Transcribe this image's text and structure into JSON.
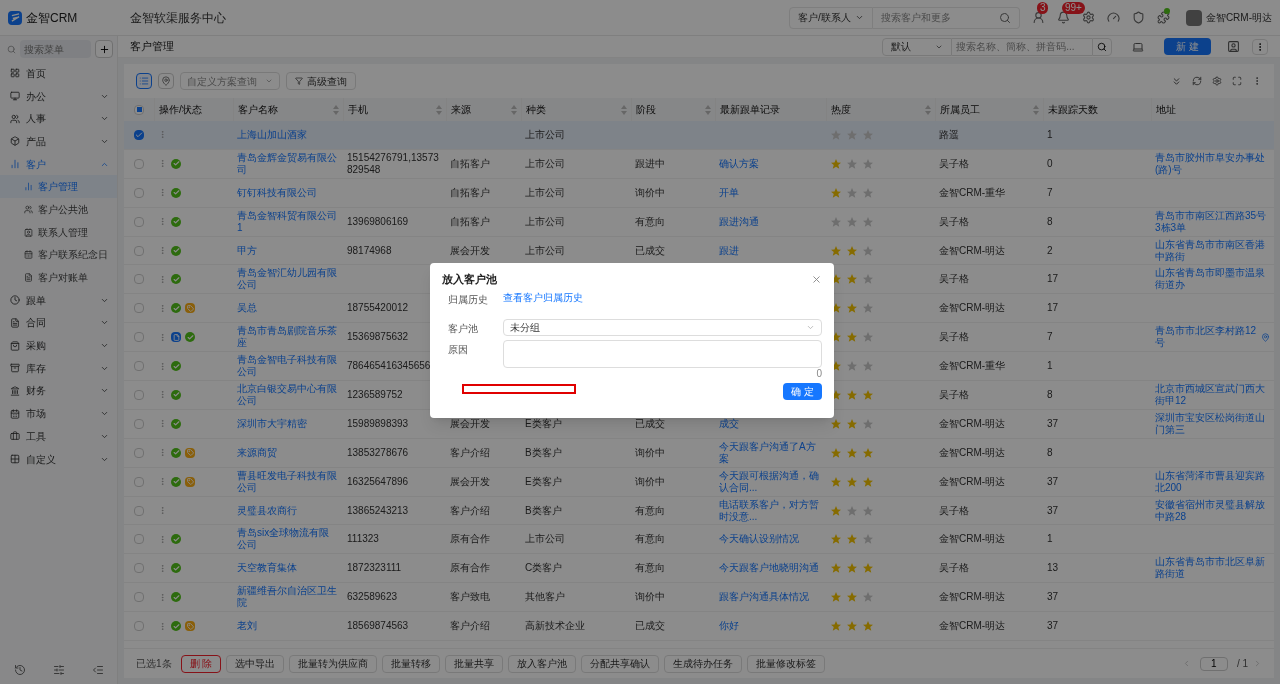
{
  "app": {
    "brand": "金智CRM",
    "title": "金智软渠服务中心",
    "search_scope": "客户/联系人",
    "search_placeholder": "搜索客户和更多",
    "badges": [
      {
        "count": "3"
      },
      {
        "count": "99+"
      }
    ],
    "status_dot": true,
    "user": "金智CRM-明达"
  },
  "sidebar": {
    "search_placeholder": "搜索菜单",
    "items": [
      {
        "label": "首页"
      },
      {
        "label": "办公",
        "expanded": false
      },
      {
        "label": "人事",
        "expanded": false
      },
      {
        "label": "产品",
        "expanded": false
      },
      {
        "label": "客户",
        "expanded": true,
        "selected": true,
        "children": [
          {
            "label": "客户管理",
            "selected": true
          },
          {
            "label": "客户公共池",
            "selected": false
          },
          {
            "label": "联系人管理",
            "selected": false
          },
          {
            "label": "客户联系纪念日",
            "selected": false
          },
          {
            "label": "客户对账单",
            "selected": false
          }
        ]
      },
      {
        "label": "跟单",
        "expanded": false
      },
      {
        "label": "合同",
        "expanded": false
      },
      {
        "label": "采购",
        "expanded": false
      },
      {
        "label": "库存",
        "expanded": false
      },
      {
        "label": "财务",
        "expanded": false
      },
      {
        "label": "市场",
        "expanded": false
      },
      {
        "label": "工具",
        "expanded": false
      },
      {
        "label": "自定义",
        "expanded": false
      }
    ]
  },
  "page": {
    "title": "客户管理",
    "scheme": "默认",
    "search_placeholder": "搜索名称、簡称、拼音码...",
    "new_button": "新 建",
    "view_list_selected": true,
    "filter_placeholder": "自定义方案查询",
    "advanced": "高级查询"
  },
  "table": {
    "header_checkbox": {
      "indeterminate": true
    },
    "columns": [
      {
        "label": "操作/状态",
        "sortable": false
      },
      {
        "label": "客户名称",
        "sortable": true
      },
      {
        "label": "手机",
        "sortable": true
      },
      {
        "label": "来源",
        "sortable": true
      },
      {
        "label": "种类",
        "sortable": true
      },
      {
        "label": "阶段",
        "sortable": true
      },
      {
        "label": "最新跟单记录",
        "sortable": false
      },
      {
        "label": "热度",
        "sortable": true
      },
      {
        "label": "所属员工",
        "sortable": true
      },
      {
        "label": "未跟踪天数",
        "sortable": false
      },
      {
        "label": "地址",
        "sortable": false
      }
    ],
    "rows": [
      {
        "selected": true,
        "status": [],
        "name": "上海山加山酒家",
        "type": "上市公司",
        "stars": 0,
        "employee": "路遥",
        "days": "1"
      },
      {
        "selected": false,
        "status": [
          {
            "kind": "ok"
          }
        ],
        "name": "青岛金辉金贸易有限公司",
        "phone": "15154276791,13573829548",
        "source": "自拓客户",
        "type": "上市公司",
        "stage": "跟进中",
        "record": "确认方案",
        "stars": 1,
        "employee": "吴子格",
        "days": "0",
        "address": "青岛市胶州市阜安办事处(路)号"
      },
      {
        "selected": false,
        "status": [
          {
            "kind": "ok"
          }
        ],
        "name": "钉钉科技有限公司",
        "source": "自拓客户",
        "type": "上市公司",
        "stage": "询价中",
        "record": "开单",
        "stars": 1,
        "employee": "金智CRM-重华",
        "days": "7"
      },
      {
        "selected": false,
        "status": [
          {
            "kind": "ok"
          }
        ],
        "name": "青岛金智科贸有限公司1",
        "phone": "13969806169",
        "source": "自拓客户",
        "type": "上市公司",
        "stage": "有意向",
        "record": "跟进沟通",
        "stars": 0,
        "employee": "吴子格",
        "days": "8",
        "address": "青岛市市南区江西路35号3栋3单"
      },
      {
        "selected": false,
        "status": [
          {
            "kind": "ok"
          }
        ],
        "name": "甲方",
        "phone": "98174968",
        "source": "展会开发",
        "type": "上市公司",
        "stage": "已成交",
        "record": "跟进",
        "stars": 2,
        "employee": "金智CRM-明达",
        "days": "2",
        "address": "山东省青岛市市南区香港中路街"
      },
      {
        "selected": false,
        "status": [
          {
            "kind": "ok"
          }
        ],
        "name": "青岛金智汇幼儿园有限公司",
        "stars": 2,
        "employee": "吴子格",
        "days": "17",
        "address": "山东省青岛市即墨市温泉街道办"
      },
      {
        "selected": false,
        "status": [
          {
            "kind": "ok"
          },
          {
            "kind": "tag"
          }
        ],
        "name": "吴总",
        "phone": "18755420012",
        "stars": 2,
        "employee": "金智CRM-明达",
        "days": "17"
      },
      {
        "selected": false,
        "status": [
          {
            "kind": "doc"
          },
          {
            "kind": "ok"
          }
        ],
        "name": "青岛市青岛剧院音乐茶座",
        "phone": "15369875632",
        "stars": 2,
        "employee": "吴子格",
        "days": "7",
        "address": "青岛市市北区李村路12号",
        "pin": true
      },
      {
        "selected": false,
        "status": [
          {
            "kind": "ok"
          }
        ],
        "name": "青岛金智电子科技有限公司",
        "phone": "786465416345656",
        "stars": 1,
        "employee": "金智CRM-重华",
        "days": "1"
      },
      {
        "selected": false,
        "status": [
          {
            "kind": "ok"
          }
        ],
        "name": "北京白银交易中心有限公司",
        "phone": "1236589752",
        "stars": 3,
        "employee": "吴子格",
        "days": "8",
        "address": "北京市西城区宣武门西大街甲12"
      },
      {
        "selected": false,
        "status": [
          {
            "kind": "ok"
          }
        ],
        "name": "深圳市大宇精密",
        "phone": "15989898393",
        "source": "展会开发",
        "type": "E类客户",
        "stage": "已成交",
        "record": "成交",
        "stars": 2,
        "employee": "金智CRM-明达",
        "days": "37",
        "address": "深圳市宝安区松岗街道山门第三"
      },
      {
        "selected": false,
        "status": [
          {
            "kind": "ok"
          },
          {
            "kind": "tag"
          }
        ],
        "name": "来源商贸",
        "phone": "13853278676",
        "source": "客户介绍",
        "type": "B类客户",
        "stage": "询价中",
        "record": "今天跟客户沟通了A方案",
        "stars": 3,
        "employee": "金智CRM-明达",
        "days": "8"
      },
      {
        "selected": false,
        "status": [
          {
            "kind": "ok"
          },
          {
            "kind": "tag"
          }
        ],
        "name": "曹县旺发电子科技有限公司",
        "phone": "16325647896",
        "source": "展会开发",
        "type": "E类客户",
        "stage": "询价中",
        "record": "今天跟可根据沟通，确认合同...",
        "stars": 3,
        "employee": "金智CRM-明达",
        "days": "37",
        "address": "山东省菏泽市曹县迎宾路北200"
      },
      {
        "selected": false,
        "status": [],
        "name": "灵璧县农商行",
        "phone": "13865243213",
        "source": "客户介绍",
        "type": "B类客户",
        "stage": "有意向",
        "record": "电话联系客户，对方暂时没意...",
        "stars": 1,
        "employee": "吴子格",
        "days": "37",
        "address": "安徽省宿州市灵璧县解放中路28"
      },
      {
        "selected": false,
        "status": [
          {
            "kind": "ok"
          }
        ],
        "name": "青岛six全球物流有限公司",
        "phone": "111323",
        "source": "原有合作",
        "type": "上市公司",
        "stage": "有意向",
        "record": "今天确认设别情况",
        "stars": 2,
        "employee": "金智CRM-明达",
        "days": "1"
      },
      {
        "selected": false,
        "status": [
          {
            "kind": "ok"
          }
        ],
        "name": "天空教育集体",
        "phone": "1872323111",
        "source": "原有合作",
        "type": "C类客户",
        "stage": "有意向",
        "record": "今天跟客户地晓明沟通",
        "stars": 3,
        "employee": "吴子格",
        "days": "13",
        "address": "山东省青岛市市北区阜新路街道"
      },
      {
        "selected": false,
        "status": [
          {
            "kind": "ok"
          }
        ],
        "name": "新疆维吾尔自治区卫生院",
        "phone": "632589623",
        "source": "客户致电",
        "type": "其他客户",
        "stage": "询价中",
        "record": "跟客户沟通具体情况",
        "stars": 2,
        "employee": "金智CRM-明达",
        "days": "37"
      },
      {
        "selected": false,
        "status": [
          {
            "kind": "ok"
          },
          {
            "kind": "tag"
          }
        ],
        "name": "老刘",
        "phone": "18569874563",
        "source": "客户介绍",
        "type": "高新技术企业",
        "stage": "已成交",
        "record": "你好",
        "stars": 3,
        "employee": "金智CRM-明达",
        "days": "37"
      }
    ]
  },
  "footer": {
    "selected_count": "已选1条",
    "actions": [
      {
        "label": "删 除",
        "kind": "danger"
      },
      {
        "label": "选中导出",
        "kind": "normal"
      },
      {
        "label": "批量转为供应商",
        "kind": "normal"
      },
      {
        "label": "批量转移",
        "kind": "normal"
      },
      {
        "label": "批量共享",
        "kind": "normal"
      },
      {
        "label": "放入客户池",
        "kind": "normal"
      },
      {
        "label": "分配共享确认",
        "kind": "normal"
      },
      {
        "label": "生成待办任务",
        "kind": "normal"
      },
      {
        "label": "批量修改标签",
        "kind": "normal"
      }
    ],
    "page": "1",
    "total_pages": "/ 1"
  },
  "dialog": {
    "title": "放入客户池",
    "fields": [
      {
        "kind": "link",
        "label": "归属历史",
        "value": "查看客户归属历史"
      },
      {
        "kind": "select",
        "label": "客户池",
        "value": "未分组"
      },
      {
        "kind": "textarea",
        "label": "原因",
        "count": "0"
      }
    ],
    "red_outline": true,
    "confirm": "确 定"
  }
}
